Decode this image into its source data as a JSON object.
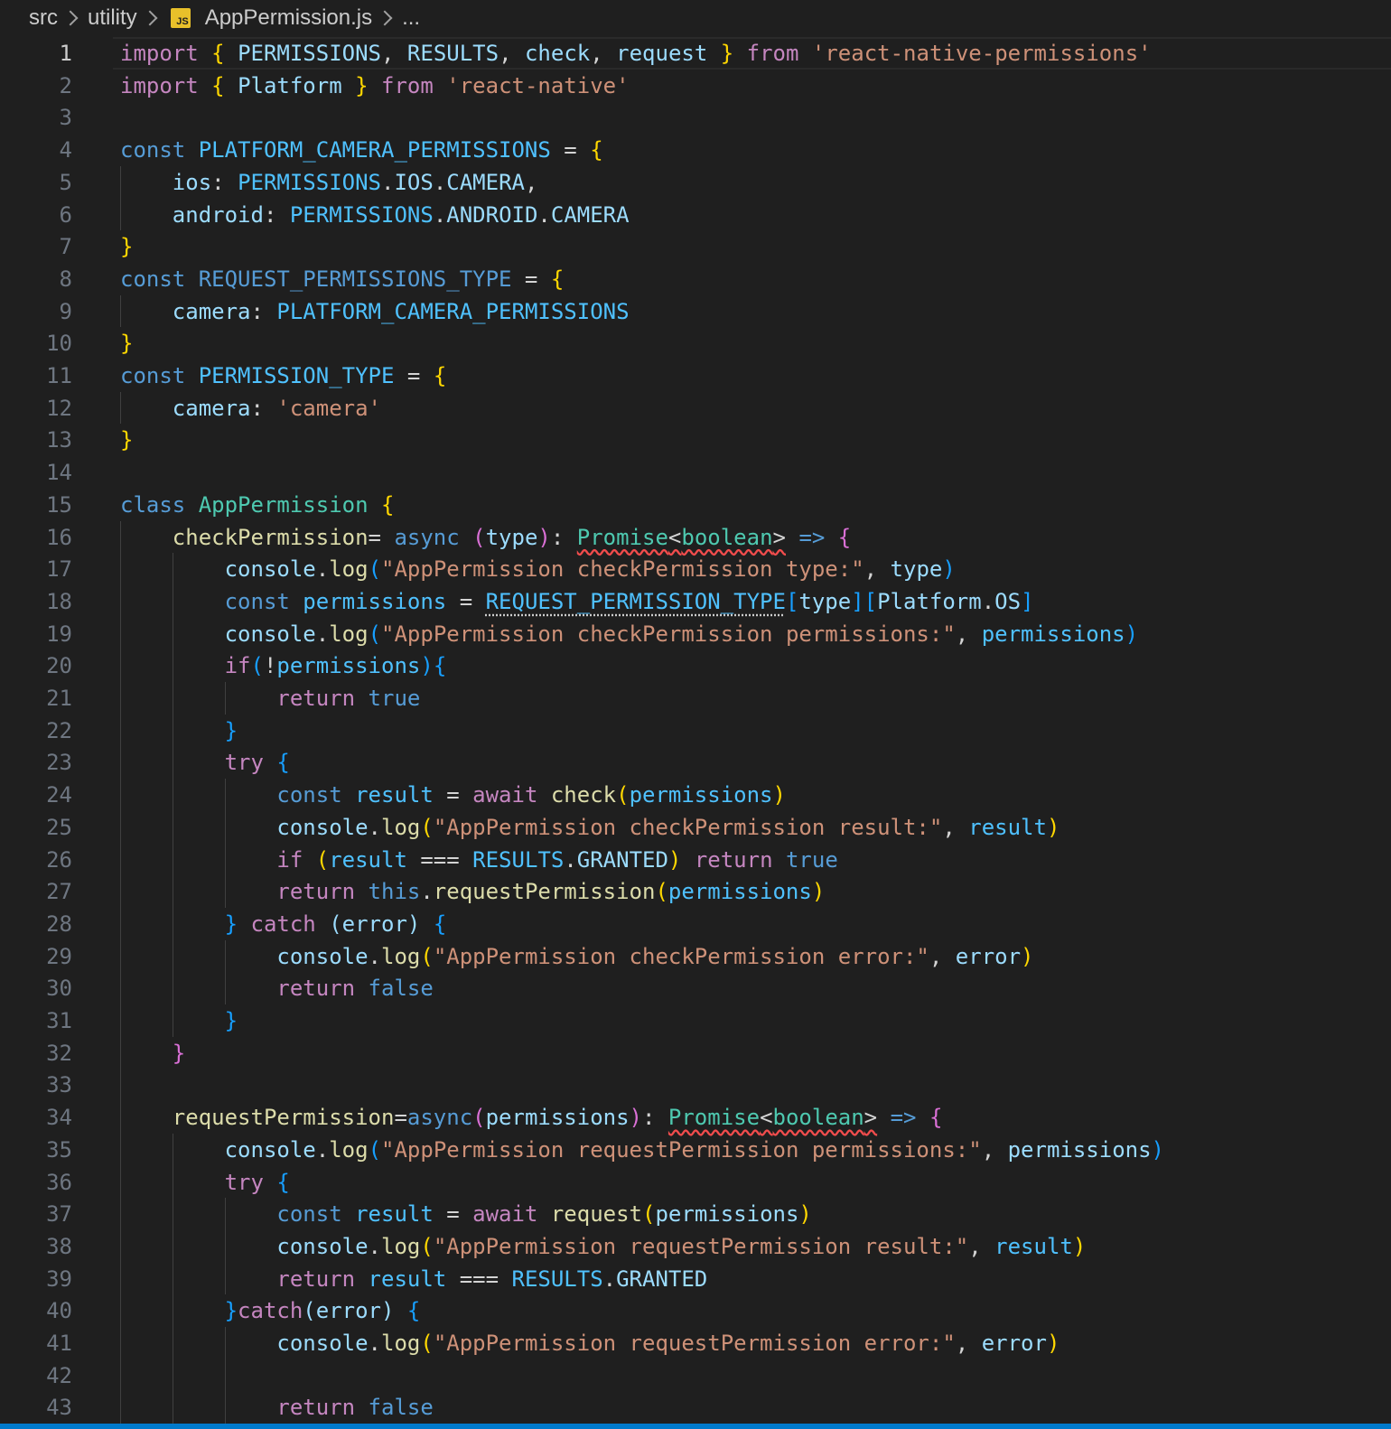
{
  "breadcrumb": {
    "items": [
      "src",
      "utility",
      "AppPermission.js",
      "..."
    ],
    "file_icon_text": "JS"
  },
  "editor": {
    "current_line": 1,
    "colors": {
      "kw": "#569cd6",
      "ctl": "#c586c0",
      "str": "#ce9178",
      "cst": "#4fc1ff",
      "var": "#9cdcfe",
      "fn": "#dcdcaa",
      "cls": "#4ec9b0",
      "y": "#ffd700",
      "pk": "#da70d6",
      "bl": "#179fff",
      "pl": "#d4d4d4"
    },
    "lines": [
      [
        [
          "ctl",
          "import"
        ],
        [
          "pl",
          " "
        ],
        [
          "y",
          "{"
        ],
        [
          "pl",
          " "
        ],
        [
          "var",
          "PERMISSIONS"
        ],
        [
          "pl",
          ", "
        ],
        [
          "var",
          "RESULTS"
        ],
        [
          "pl",
          ", "
        ],
        [
          "var",
          "check"
        ],
        [
          "pl",
          ", "
        ],
        [
          "var",
          "request"
        ],
        [
          "pl",
          " "
        ],
        [
          "y",
          "}"
        ],
        [
          "pl",
          " "
        ],
        [
          "ctl",
          "from"
        ],
        [
          "pl",
          " "
        ],
        [
          "str",
          "'react-native-permissions'"
        ]
      ],
      [
        [
          "ctl",
          "import"
        ],
        [
          "pl",
          " "
        ],
        [
          "y",
          "{"
        ],
        [
          "pl",
          " "
        ],
        [
          "var",
          "Platform"
        ],
        [
          "pl",
          " "
        ],
        [
          "y",
          "}"
        ],
        [
          "pl",
          " "
        ],
        [
          "ctl",
          "from"
        ],
        [
          "pl",
          " "
        ],
        [
          "str",
          "'react-native'"
        ]
      ],
      [],
      [
        [
          "kw",
          "const"
        ],
        [
          "pl",
          " "
        ],
        [
          "cst",
          "PLATFORM_CAMERA_PERMISSIONS"
        ],
        [
          "pl",
          " = "
        ],
        [
          "y",
          "{"
        ]
      ],
      [
        [
          "pl",
          "    "
        ],
        [
          "var",
          "ios"
        ],
        [
          "pl",
          ": "
        ],
        [
          "cst",
          "PERMISSIONS"
        ],
        [
          "pl",
          "."
        ],
        [
          "var",
          "IOS"
        ],
        [
          "pl",
          "."
        ],
        [
          "var",
          "CAMERA"
        ],
        [
          "pl",
          ","
        ]
      ],
      [
        [
          "pl",
          "    "
        ],
        [
          "var",
          "android"
        ],
        [
          "pl",
          ": "
        ],
        [
          "cst",
          "PERMISSIONS"
        ],
        [
          "pl",
          "."
        ],
        [
          "var",
          "ANDROID"
        ],
        [
          "pl",
          "."
        ],
        [
          "var",
          "CAMERA"
        ]
      ],
      [
        [
          "y",
          "}"
        ]
      ],
      [
        [
          "kw",
          "const"
        ],
        [
          "pl",
          " "
        ],
        [
          "kw",
          "REQUEST_PERMISSIONS_TYPE"
        ],
        [
          "pl",
          " = "
        ],
        [
          "y",
          "{"
        ]
      ],
      [
        [
          "pl",
          "    "
        ],
        [
          "var",
          "camera"
        ],
        [
          "pl",
          ": "
        ],
        [
          "cst",
          "PLATFORM_CAMERA_PERMISSIONS"
        ]
      ],
      [
        [
          "y",
          "}"
        ]
      ],
      [
        [
          "kw",
          "const"
        ],
        [
          "pl",
          " "
        ],
        [
          "cst",
          "PERMISSION_TYPE"
        ],
        [
          "pl",
          " = "
        ],
        [
          "y",
          "{"
        ]
      ],
      [
        [
          "pl",
          "    "
        ],
        [
          "var",
          "camera"
        ],
        [
          "pl",
          ": "
        ],
        [
          "str",
          "'camera'"
        ]
      ],
      [
        [
          "y",
          "}"
        ]
      ],
      [],
      [
        [
          "kw",
          "class"
        ],
        [
          "pl",
          " "
        ],
        [
          "cls",
          "AppPermission"
        ],
        [
          "pl",
          " "
        ],
        [
          "y",
          "{"
        ]
      ],
      [
        [
          "pl",
          "    "
        ],
        [
          "fn",
          "checkPermission"
        ],
        [
          "pl",
          "= "
        ],
        [
          "kw",
          "async"
        ],
        [
          "pl",
          " "
        ],
        [
          "pk",
          "("
        ],
        [
          "var",
          "type"
        ],
        [
          "pk",
          ")"
        ],
        [
          "pl",
          ": "
        ],
        [
          "cls squiggle",
          "Promise"
        ],
        [
          "pl squiggle",
          "<"
        ],
        [
          "cls squiggle",
          "boolean"
        ],
        [
          "pl squiggle",
          ">"
        ],
        [
          "pl",
          " "
        ],
        [
          "kw",
          "=>"
        ],
        [
          "pl",
          " "
        ],
        [
          "pk",
          "{"
        ]
      ],
      [
        [
          "pl",
          "        "
        ],
        [
          "var",
          "console"
        ],
        [
          "pl",
          "."
        ],
        [
          "fn",
          "log"
        ],
        [
          "bl",
          "("
        ],
        [
          "str",
          "\"AppPermission checkPermission type:\""
        ],
        [
          "pl",
          ", "
        ],
        [
          "var",
          "type"
        ],
        [
          "bl",
          ")"
        ]
      ],
      [
        [
          "pl",
          "        "
        ],
        [
          "kw",
          "const"
        ],
        [
          "pl",
          " "
        ],
        [
          "cst",
          "permissions"
        ],
        [
          "pl",
          " = "
        ],
        [
          "cst dotted",
          "REQUEST_PERMISSION_TYPE"
        ],
        [
          "bl",
          "["
        ],
        [
          "var",
          "type"
        ],
        [
          "bl",
          "]"
        ],
        [
          "bl",
          "["
        ],
        [
          "var",
          "Platform"
        ],
        [
          "pl",
          "."
        ],
        [
          "var",
          "OS"
        ],
        [
          "bl",
          "]"
        ]
      ],
      [
        [
          "pl",
          "        "
        ],
        [
          "var",
          "console"
        ],
        [
          "pl",
          "."
        ],
        [
          "fn",
          "log"
        ],
        [
          "bl",
          "("
        ],
        [
          "str",
          "\"AppPermission checkPermission permissions:\""
        ],
        [
          "pl",
          ", "
        ],
        [
          "cst",
          "permissions"
        ],
        [
          "bl",
          ")"
        ]
      ],
      [
        [
          "pl",
          "        "
        ],
        [
          "ctl",
          "if"
        ],
        [
          "bl",
          "("
        ],
        [
          "pl",
          "!"
        ],
        [
          "cst",
          "permissions"
        ],
        [
          "bl",
          ")"
        ],
        [
          "bl",
          "{"
        ]
      ],
      [
        [
          "pl",
          "            "
        ],
        [
          "ctl",
          "return"
        ],
        [
          "pl",
          " "
        ],
        [
          "kw",
          "true"
        ]
      ],
      [
        [
          "pl",
          "        "
        ],
        [
          "bl",
          "}"
        ]
      ],
      [
        [
          "pl",
          "        "
        ],
        [
          "ctl",
          "try"
        ],
        [
          "pl",
          " "
        ],
        [
          "bl",
          "{"
        ]
      ],
      [
        [
          "pl",
          "            "
        ],
        [
          "kw",
          "const"
        ],
        [
          "pl",
          " "
        ],
        [
          "cst",
          "result"
        ],
        [
          "pl",
          " = "
        ],
        [
          "ctl",
          "await"
        ],
        [
          "pl",
          " "
        ],
        [
          "fn",
          "check"
        ],
        [
          "y",
          "("
        ],
        [
          "cst",
          "permissions"
        ],
        [
          "y",
          ")"
        ]
      ],
      [
        [
          "pl",
          "            "
        ],
        [
          "var",
          "console"
        ],
        [
          "pl",
          "."
        ],
        [
          "fn",
          "log"
        ],
        [
          "y",
          "("
        ],
        [
          "str",
          "\"AppPermission checkPermission result:\""
        ],
        [
          "pl",
          ", "
        ],
        [
          "cst",
          "result"
        ],
        [
          "y",
          ")"
        ]
      ],
      [
        [
          "pl",
          "            "
        ],
        [
          "ctl",
          "if"
        ],
        [
          "pl",
          " "
        ],
        [
          "y",
          "("
        ],
        [
          "cst",
          "result"
        ],
        [
          "pl",
          " === "
        ],
        [
          "cst",
          "RESULTS"
        ],
        [
          "pl",
          "."
        ],
        [
          "var",
          "GRANTED"
        ],
        [
          "y",
          ")"
        ],
        [
          "pl",
          " "
        ],
        [
          "ctl",
          "return"
        ],
        [
          "pl",
          " "
        ],
        [
          "kw",
          "true"
        ]
      ],
      [
        [
          "pl",
          "            "
        ],
        [
          "ctl",
          "return"
        ],
        [
          "pl",
          " "
        ],
        [
          "kw",
          "this"
        ],
        [
          "pl",
          "."
        ],
        [
          "fn",
          "requestPermission"
        ],
        [
          "y",
          "("
        ],
        [
          "cst",
          "permissions"
        ],
        [
          "y",
          ")"
        ]
      ],
      [
        [
          "pl",
          "        "
        ],
        [
          "bl",
          "}"
        ],
        [
          "pl",
          " "
        ],
        [
          "ctl",
          "catch"
        ],
        [
          "pl",
          " "
        ],
        [
          "var",
          "("
        ],
        [
          "var",
          "error"
        ],
        [
          "var",
          ")"
        ],
        [
          "pl",
          " "
        ],
        [
          "bl",
          "{"
        ]
      ],
      [
        [
          "pl",
          "            "
        ],
        [
          "var",
          "console"
        ],
        [
          "pl",
          "."
        ],
        [
          "fn",
          "log"
        ],
        [
          "y",
          "("
        ],
        [
          "str",
          "\"AppPermission checkPermission error:\""
        ],
        [
          "pl",
          ", "
        ],
        [
          "var",
          "error"
        ],
        [
          "y",
          ")"
        ]
      ],
      [
        [
          "pl",
          "            "
        ],
        [
          "ctl",
          "return"
        ],
        [
          "pl",
          " "
        ],
        [
          "kw",
          "false"
        ]
      ],
      [
        [
          "pl",
          "        "
        ],
        [
          "bl",
          "}"
        ]
      ],
      [
        [
          "pl",
          "    "
        ],
        [
          "pk",
          "}"
        ]
      ],
      [],
      [
        [
          "pl",
          "    "
        ],
        [
          "fn",
          "requestPermission"
        ],
        [
          "pl",
          "="
        ],
        [
          "kw",
          "async"
        ],
        [
          "pk",
          "("
        ],
        [
          "var",
          "permissions"
        ],
        [
          "pk",
          ")"
        ],
        [
          "pl",
          ": "
        ],
        [
          "cls squiggle",
          "Promise"
        ],
        [
          "pl squiggle",
          "<"
        ],
        [
          "cls squiggle",
          "boolean"
        ],
        [
          "pl squiggle",
          ">"
        ],
        [
          "pl",
          " "
        ],
        [
          "kw",
          "=>"
        ],
        [
          "pl",
          " "
        ],
        [
          "pk",
          "{"
        ]
      ],
      [
        [
          "pl",
          "        "
        ],
        [
          "var",
          "console"
        ],
        [
          "pl",
          "."
        ],
        [
          "fn",
          "log"
        ],
        [
          "bl",
          "("
        ],
        [
          "str",
          "\"AppPermission requestPermission permissions:\""
        ],
        [
          "pl",
          ", "
        ],
        [
          "var",
          "permissions"
        ],
        [
          "bl",
          ")"
        ]
      ],
      [
        [
          "pl",
          "        "
        ],
        [
          "ctl",
          "try"
        ],
        [
          "pl",
          " "
        ],
        [
          "bl",
          "{"
        ]
      ],
      [
        [
          "pl",
          "            "
        ],
        [
          "kw",
          "const"
        ],
        [
          "pl",
          " "
        ],
        [
          "cst",
          "result"
        ],
        [
          "pl",
          " = "
        ],
        [
          "ctl",
          "await"
        ],
        [
          "pl",
          " "
        ],
        [
          "fn",
          "request"
        ],
        [
          "y",
          "("
        ],
        [
          "var",
          "permissions"
        ],
        [
          "y",
          ")"
        ]
      ],
      [
        [
          "pl",
          "            "
        ],
        [
          "var",
          "console"
        ],
        [
          "pl",
          "."
        ],
        [
          "fn",
          "log"
        ],
        [
          "y",
          "("
        ],
        [
          "str",
          "\"AppPermission requestPermission result:\""
        ],
        [
          "pl",
          ", "
        ],
        [
          "cst",
          "result"
        ],
        [
          "y",
          ")"
        ]
      ],
      [
        [
          "pl",
          "            "
        ],
        [
          "ctl",
          "return"
        ],
        [
          "pl",
          " "
        ],
        [
          "cst",
          "result"
        ],
        [
          "pl",
          " === "
        ],
        [
          "cst",
          "RESULTS"
        ],
        [
          "pl",
          "."
        ],
        [
          "var",
          "GRANTED"
        ]
      ],
      [
        [
          "pl",
          "        "
        ],
        [
          "bl",
          "}"
        ],
        [
          "ctl",
          "catch"
        ],
        [
          "var",
          "("
        ],
        [
          "var",
          "error"
        ],
        [
          "var",
          ")"
        ],
        [
          "pl",
          " "
        ],
        [
          "bl",
          "{"
        ]
      ],
      [
        [
          "pl",
          "            "
        ],
        [
          "var",
          "console"
        ],
        [
          "pl",
          "."
        ],
        [
          "fn",
          "log"
        ],
        [
          "y",
          "("
        ],
        [
          "str",
          "\"AppPermission requestPermission error:\""
        ],
        [
          "pl",
          ", "
        ],
        [
          "var",
          "error"
        ],
        [
          "y",
          ")"
        ]
      ],
      [],
      [
        [
          "pl",
          "            "
        ],
        [
          "ctl",
          "return"
        ],
        [
          "pl",
          " "
        ],
        [
          "kw",
          "false"
        ]
      ]
    ]
  }
}
